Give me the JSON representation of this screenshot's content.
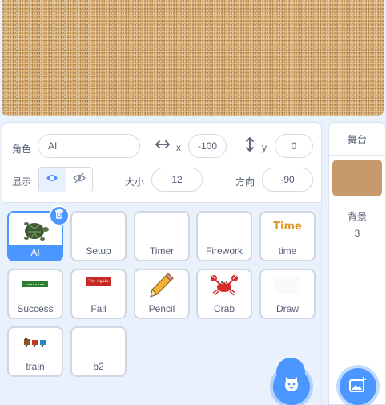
{
  "sprite_info": {
    "sprite_label": "角色",
    "sprite_name": "AI",
    "x_label": "x",
    "x_value": "-100",
    "y_label": "y",
    "y_value": "0",
    "show_label": "显示",
    "size_label": "大小",
    "size_value": "12",
    "direction_label": "方向",
    "direction_value": "-90"
  },
  "sprites": [
    {
      "name": "AI",
      "selected": true,
      "thumb": "turtle"
    },
    {
      "name": "Setup",
      "thumb": "none"
    },
    {
      "name": "Timer",
      "thumb": "none"
    },
    {
      "name": "Firework",
      "thumb": "none"
    },
    {
      "name": "time",
      "thumb": "text",
      "thumb_text": "Time"
    },
    {
      "name": "Success",
      "thumb": "green-banner"
    },
    {
      "name": "Fail",
      "thumb": "red-banner",
      "thumb_text": "Try Again"
    },
    {
      "name": "Pencil",
      "thumb": "pencil"
    },
    {
      "name": "Crab",
      "thumb": "crab"
    },
    {
      "name": "Draw",
      "thumb": "empty-box"
    },
    {
      "name": "train",
      "thumb": "train"
    },
    {
      "name": "b2",
      "thumb": "none"
    }
  ],
  "stage_panel": {
    "title": "舞台",
    "backdrop_label": "背景",
    "backdrop_count": "3"
  },
  "colors": {
    "accent": "#4c97ff",
    "add_button": "#855cd6",
    "stage_sand": "#d8ae72",
    "backdrop_thumb": "#c8996a"
  }
}
